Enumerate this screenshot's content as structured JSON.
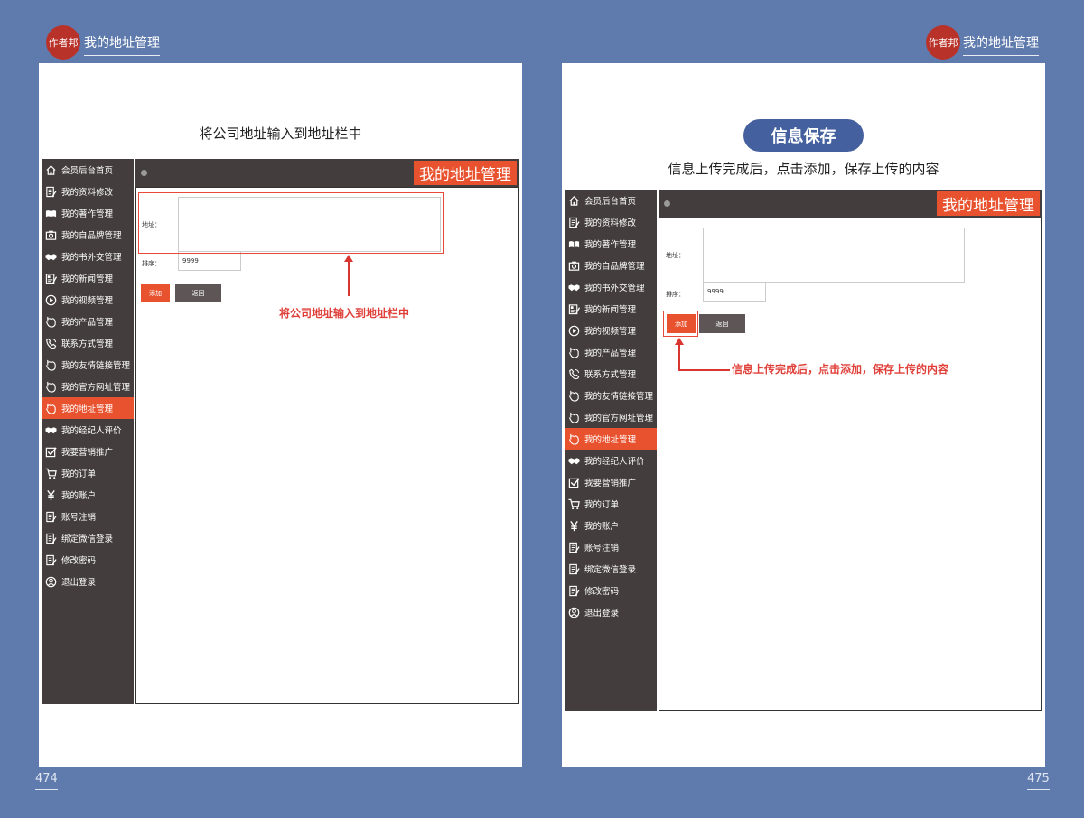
{
  "brand": "作者邦",
  "header_title": "我的地址管理",
  "left_page": {
    "page_number": "474",
    "caption": "将公司地址输入到地址栏中",
    "annotation": "将公司地址输入到地址栏中"
  },
  "right_page": {
    "page_number": "475",
    "pill": "信息保存",
    "caption": "信息上传完成后，点击添加，保存上传的内容",
    "annotation": "信息上传完成后，点击添加，保存上传的内容"
  },
  "ui": {
    "banner": "我的地址管理",
    "address_label": "地址：",
    "sort_label": "排序：",
    "sort_value": "9999",
    "add_button": "添加",
    "back_button": "返回",
    "accent_color": "#e8522e",
    "sidebar_color": "#443d3d",
    "sidebar": [
      {
        "label": "会员后台首页",
        "icon": "home-icon"
      },
      {
        "label": "我的资料修改",
        "icon": "edit-document-icon"
      },
      {
        "label": "我的著作管理",
        "icon": "open-book-icon"
      },
      {
        "label": "我的自品牌管理",
        "icon": "camera-icon"
      },
      {
        "label": "我的书外交管理",
        "icon": "handshake-icon"
      },
      {
        "label": "我的新闻管理",
        "icon": "news-icon"
      },
      {
        "label": "我的视频管理",
        "icon": "play-circle-icon"
      },
      {
        "label": "我的产品管理",
        "icon": "hand-pointer-icon"
      },
      {
        "label": "联系方式管理",
        "icon": "phone-icon"
      },
      {
        "label": "我的友情链接管理",
        "icon": "hand-pointer-icon"
      },
      {
        "label": "我的官方网址管理",
        "icon": "hand-pointer-icon"
      },
      {
        "label": "我的地址管理",
        "icon": "hand-pointer-icon",
        "active": true
      },
      {
        "label": "我的经纪人评价",
        "icon": "handshake-icon"
      },
      {
        "label": "我要营销推广",
        "icon": "checkbox-icon"
      },
      {
        "label": "我的订单",
        "icon": "cart-icon"
      },
      {
        "label": "我的账户",
        "icon": "yen-icon"
      },
      {
        "label": "账号注销",
        "icon": "edit-document-icon"
      },
      {
        "label": "绑定微信登录",
        "icon": "edit-document-icon"
      },
      {
        "label": "修改密码",
        "icon": "edit-document-icon"
      },
      {
        "label": "退出登录",
        "icon": "user-circle-icon"
      }
    ]
  }
}
